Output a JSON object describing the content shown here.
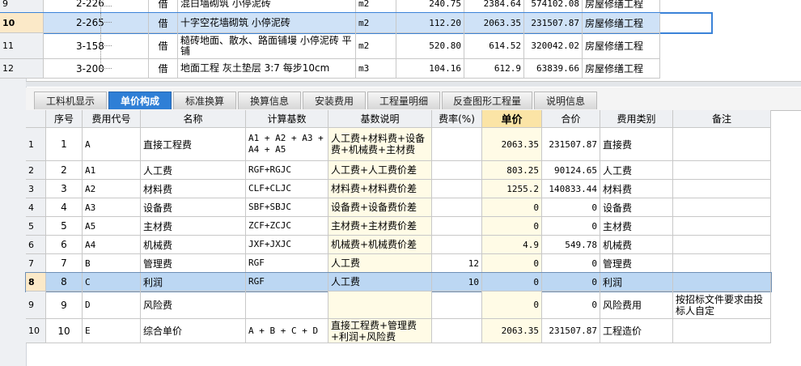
{
  "top_rows": [
    {
      "row": "9",
      "code": "2-226",
      "type": "借",
      "name": "混白墙砌筑 小停泥砖",
      "unit": "m2",
      "qty": "240.75",
      "price": "2384.64",
      "total": "574102.08",
      "profession": "房屋修缮工程"
    },
    {
      "row": "10",
      "code": "2-265",
      "type": "借",
      "name": "十字空花墙砌筑 小停泥砖",
      "unit": "m2",
      "qty": "112.20",
      "price": "2063.35",
      "total": "231507.87",
      "profession": "房屋修缮工程"
    },
    {
      "row": "11",
      "code": "3-158",
      "type": "借",
      "name": "糙砖地面、散水、路面铺墁 小停泥砖 平铺",
      "unit": "m2",
      "qty": "520.80",
      "price": "614.52",
      "total": "320042.02",
      "profession": "房屋修缮工程"
    },
    {
      "row": "12",
      "code": "3-200",
      "type": "借",
      "name": "地面工程 灰土垫层 3:7 每步10cm",
      "unit": "m3",
      "qty": "104.16",
      "price": "612.9",
      "total": "63839.66",
      "profession": "房屋修缮工程"
    }
  ],
  "tabs": [
    "工料机显示",
    "单价构成",
    "标准换算",
    "换算信息",
    "安装费用",
    "工程量明细",
    "反查图形工程量",
    "说明信息"
  ],
  "active_tab": 1,
  "headers": {
    "seq": "序号",
    "code": "费用代号",
    "name": "名称",
    "base": "计算基数",
    "desc": "基数说明",
    "rate": "费率(%)",
    "price": "单价",
    "total": "合价",
    "category": "费用类别",
    "note": "备注"
  },
  "rows": [
    {
      "row": "1",
      "seq": "1",
      "code": "A",
      "name": "直接工程费",
      "base": "A1 + A2 + A3 + A4 + A5",
      "desc": "人工费+材料费+设备费+机械费+主材费",
      "rate": "",
      "price": "2063.35",
      "total": "231507.87",
      "category": "直接费",
      "note": ""
    },
    {
      "row": "2",
      "seq": "2",
      "code": "A1",
      "name": "人工费",
      "base": "RGF+RGJC",
      "desc": "人工费+人工费价差",
      "rate": "",
      "price": "803.25",
      "total": "90124.65",
      "category": "人工费",
      "note": ""
    },
    {
      "row": "3",
      "seq": "3",
      "code": "A2",
      "name": "材料费",
      "base": "CLF+CLJC",
      "desc": "材料费+材料费价差",
      "rate": "",
      "price": "1255.2",
      "total": "140833.44",
      "category": "材料费",
      "note": ""
    },
    {
      "row": "4",
      "seq": "4",
      "code": "A3",
      "name": "设备费",
      "base": "SBF+SBJC",
      "desc": "设备费+设备费价差",
      "rate": "",
      "price": "0",
      "total": "0",
      "category": "设备费",
      "note": ""
    },
    {
      "row": "5",
      "seq": "5",
      "code": "A5",
      "name": "主材费",
      "base": "ZCF+ZCJC",
      "desc": "主材费+主材费价差",
      "rate": "",
      "price": "0",
      "total": "0",
      "category": "主材费",
      "note": ""
    },
    {
      "row": "6",
      "seq": "6",
      "code": "A4",
      "name": "机械费",
      "base": "JXF+JXJC",
      "desc": "机械费+机械费价差",
      "rate": "",
      "price": "4.9",
      "total": "549.78",
      "category": "机械费",
      "note": ""
    },
    {
      "row": "7",
      "seq": "7",
      "code": "B",
      "name": "管理费",
      "base": "RGF",
      "desc": "人工费",
      "rate": "12",
      "price": "0",
      "total": "0",
      "category": "管理费",
      "note": ""
    },
    {
      "row": "8",
      "seq": "8",
      "code": "C",
      "name": "利润",
      "base": "RGF",
      "desc": "人工费",
      "rate": "10",
      "price": "0",
      "total": "0",
      "category": "利润",
      "note": ""
    },
    {
      "row": "9",
      "seq": "9",
      "code": "D",
      "name": "风险费",
      "base": "",
      "desc": "",
      "rate": "",
      "price": "0",
      "total": "0",
      "category": "风险费用",
      "note": "按招标文件要求由投标人自定"
    },
    {
      "row": "10",
      "seq": "10",
      "code": "E",
      "name": "综合单价",
      "base": "A + B + C + D",
      "desc": "直接工程费+管理费+利润+风险费",
      "rate": "",
      "price": "2063.35",
      "total": "231507.87",
      "category": "工程造价",
      "note": ""
    }
  ]
}
